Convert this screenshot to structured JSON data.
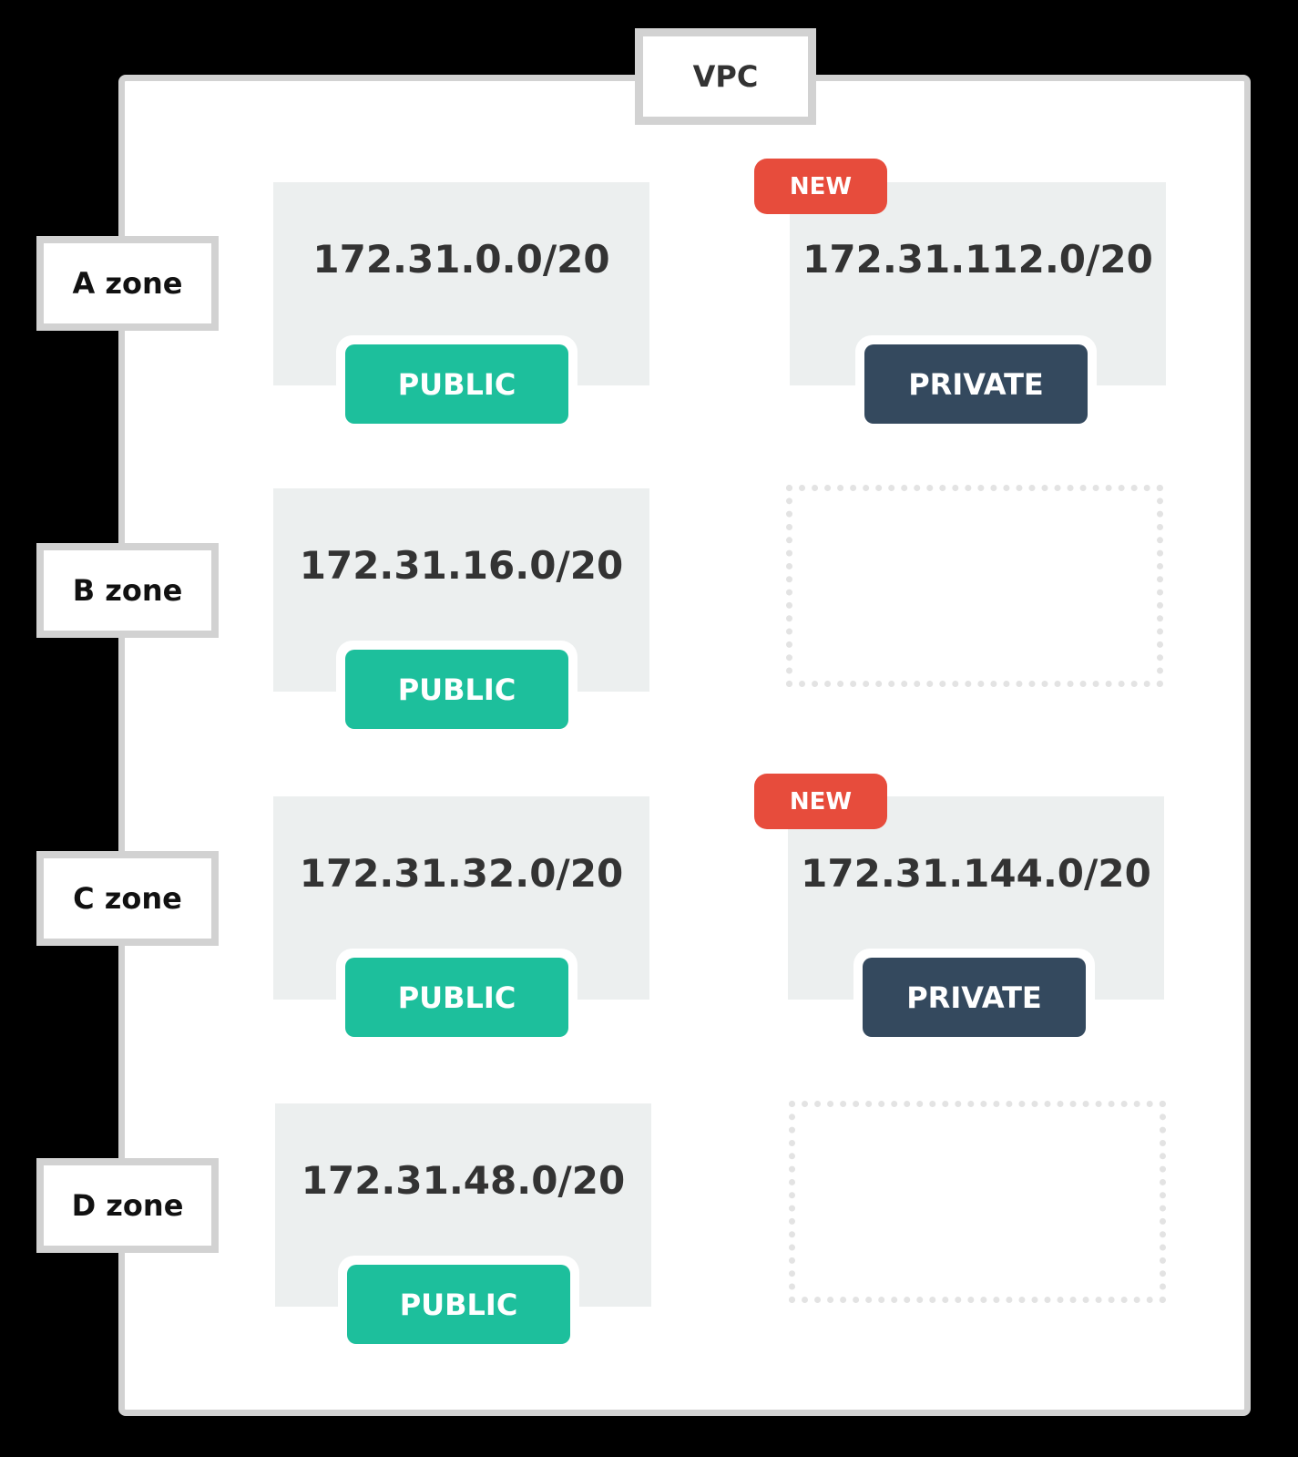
{
  "colors": {
    "public": "#1dbf9c",
    "private": "#34495e",
    "new": "#e74c3c"
  },
  "vpc": {
    "label": "VPC"
  },
  "zones": [
    {
      "label": "A zone"
    },
    {
      "label": "B zone"
    },
    {
      "label": "C zone"
    },
    {
      "label": "D zone"
    }
  ],
  "subnets": [
    {
      "cidr": "172.31.0.0/20",
      "type": "PUBLIC"
    },
    {
      "cidr": "172.31.112.0/20",
      "type": "PRIVATE",
      "badge": "NEW"
    },
    {
      "cidr": "172.31.16.0/20",
      "type": "PUBLIC"
    },
    {
      "cidr": "172.31.32.0/20",
      "type": "PUBLIC"
    },
    {
      "cidr": "172.31.144.0/20",
      "type": "PRIVATE",
      "badge": "NEW"
    },
    {
      "cidr": "172.31.48.0/20",
      "type": "PUBLIC"
    }
  ]
}
